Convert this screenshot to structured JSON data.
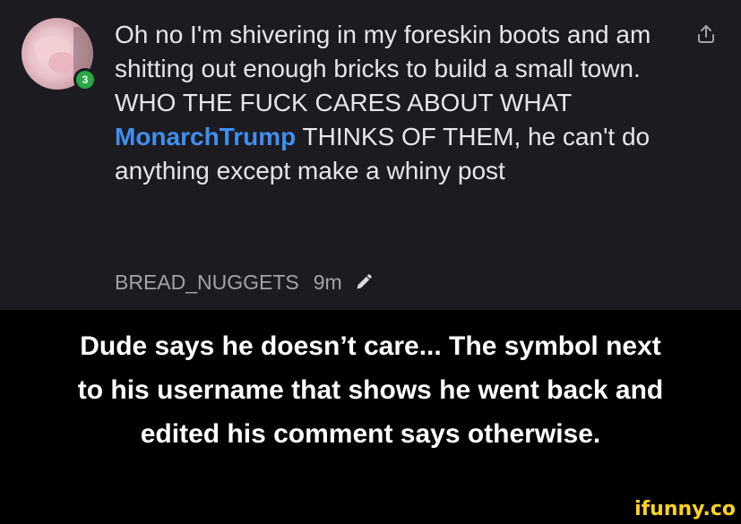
{
  "comment": {
    "karma_badge": "3",
    "text_before_mention": "Oh no I'm shivering in my foreskin boots and am shitting out enough bricks to build a small town. WHO THE FUCK CARES ABOUT WHAT ",
    "mention": "MonarchTrump",
    "text_after_mention": " THINKS OF THEM, he can't do anything except make a whiny post",
    "username": "BREAD_NUGGETS",
    "time": "9m",
    "mention_color": "#3f8ff0",
    "badge_color": "#27a844"
  },
  "icons": {
    "share": "share-icon",
    "edited": "pencil-icon"
  },
  "caption": {
    "line1": "Dude says he doesn’t care... The symbol next",
    "line2": "to his username that shows he went back and",
    "line3": "edited his comment says otherwise."
  },
  "watermark": "ifunny.co"
}
